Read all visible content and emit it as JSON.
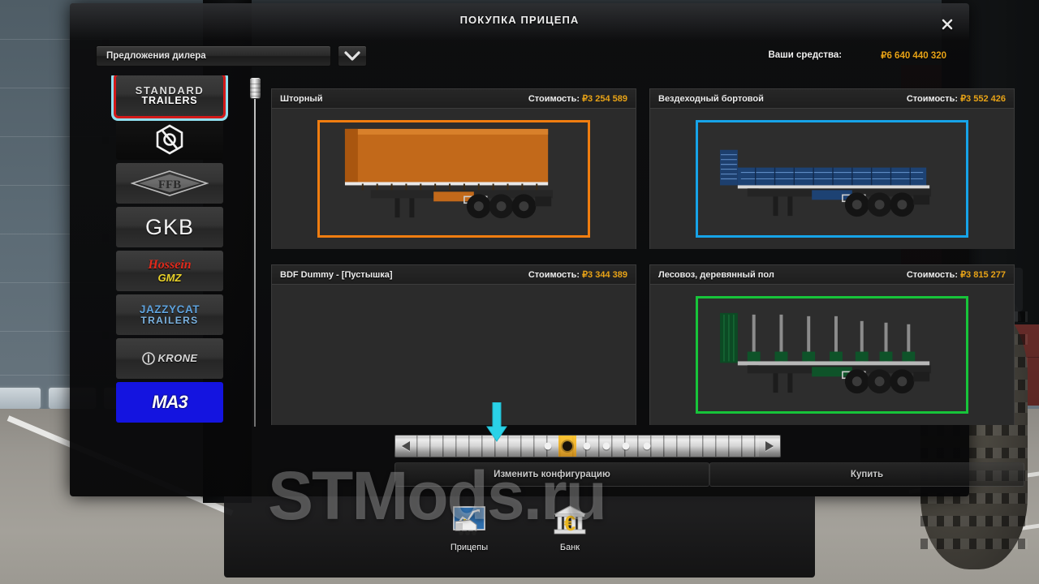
{
  "window": {
    "title": "ПОКУПКА ПРИЦЕПА",
    "close_icon": "close-icon"
  },
  "toolbar": {
    "dropdown_value": "Предложения дилера",
    "dropdown_icon": "chevron-down-icon",
    "funds_label": "Ваши средства:",
    "funds_value": "₽6 640 440 320",
    "funds_color": "#e8a317"
  },
  "brands": [
    {
      "id": "standard-trailers",
      "line1": "STANDARD",
      "line2": "TRAILERS",
      "selected": true
    },
    {
      "id": "hexagon-logo",
      "line1": "",
      "line2": "",
      "selected": false
    },
    {
      "id": "ffb",
      "line1": "FFB",
      "line2": "",
      "selected": false
    },
    {
      "id": "gkb",
      "line1": "GKB",
      "line2": "",
      "selected": false
    },
    {
      "id": "hossein-gmz",
      "line1": "Hossein",
      "line2": "GMZ",
      "selected": false
    },
    {
      "id": "jazzycat-trailers",
      "line1": "JAZZYCAT",
      "line2": "TRAILERS",
      "selected": false
    },
    {
      "id": "krone",
      "line1": "KRONE",
      "line2": "",
      "selected": false
    },
    {
      "id": "maz",
      "line1": "MA3",
      "line2": "",
      "selected": false
    }
  ],
  "cards": [
    {
      "name": "Шторный",
      "price_label": "Стоимость:",
      "price_value": "₽3 254 589",
      "border_color": "#f07d10",
      "has_image": true,
      "image_kind": "curtain-side-trailer"
    },
    {
      "name": "Вездеходный бортовой",
      "price_label": "Стоимость:",
      "price_value": "₽3 552 426",
      "border_color": "#16a3e8",
      "has_image": true,
      "image_kind": "flatbed-trailer"
    },
    {
      "name": "BDF Dummy - [Пустышка]",
      "price_label": "Стоимость:",
      "price_value": "₽3 344 389",
      "border_color": "",
      "has_image": false,
      "image_kind": "none"
    },
    {
      "name": "Лесовоз, деревянный пол",
      "price_label": "Стоимость:",
      "price_value": "₽3 815 277",
      "border_color": "#17c43a",
      "has_image": true,
      "image_kind": "log-carrier-trailer"
    }
  ],
  "pager": {
    "prev_icon": "triangle-left-icon",
    "next_icon": "triangle-right-icon",
    "dot_count": 6,
    "active_index": 1,
    "cursor_icon": "down-arrow-cursor"
  },
  "buttons": {
    "configure": "Изменить конфигурацию",
    "buy": "Купить"
  },
  "taskbar": {
    "items": [
      {
        "label": "Прицепы",
        "icon": "trailers-icon"
      },
      {
        "label": "Банк",
        "icon": "bank-icon"
      }
    ]
  },
  "overlay": {
    "watermark": "STMods.ru"
  }
}
